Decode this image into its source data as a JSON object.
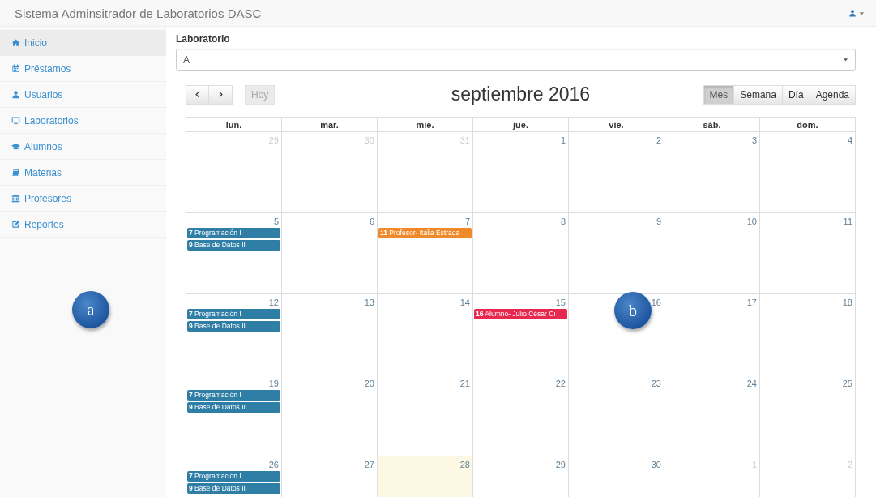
{
  "header": {
    "title": "Sistema Adminsitrador de Laboratorios DASC"
  },
  "sidebar": {
    "items": [
      {
        "label": "Inicio",
        "selected": true
      },
      {
        "label": "Préstamos",
        "selected": false
      },
      {
        "label": "Usuarios",
        "selected": false
      },
      {
        "label": "Laboratorios",
        "selected": false
      },
      {
        "label": "Alumnos",
        "selected": false
      },
      {
        "label": "Materias",
        "selected": false
      },
      {
        "label": "Profesores",
        "selected": false
      },
      {
        "label": "Reportes",
        "selected": false
      }
    ]
  },
  "lab_field": {
    "label": "Laboratorio",
    "value": "A"
  },
  "toolbar": {
    "today": {
      "label": "Hoy",
      "disabled": true
    },
    "title": "septiembre 2016",
    "views": [
      {
        "label": "Mes",
        "selected": true
      },
      {
        "label": "Semana",
        "selected": false
      },
      {
        "label": "Día",
        "selected": false
      },
      {
        "label": "Agenda",
        "selected": false
      }
    ]
  },
  "calendar": {
    "weekdays": [
      "lun.",
      "mar.",
      "mié.",
      "jue.",
      "vie.",
      "sáb.",
      "dom."
    ],
    "weeks": [
      [
        {
          "day": "29",
          "other_month": true,
          "today": false
        },
        {
          "day": "30",
          "other_month": true,
          "today": false
        },
        {
          "day": "31",
          "other_month": true,
          "today": false
        },
        {
          "day": "1",
          "other_month": false,
          "today": false
        },
        {
          "day": "2",
          "other_month": false,
          "today": false
        },
        {
          "day": "3",
          "other_month": false,
          "today": false
        },
        {
          "day": "4",
          "other_month": false,
          "today": false
        }
      ],
      [
        {
          "day": "5",
          "other_month": false,
          "today": false,
          "events": [
            {
              "time": "7",
              "title": "Programación I",
              "color": "#2f7ea6"
            },
            {
              "time": "9",
              "title": "Base de Datos II",
              "color": "#2f7ea6"
            }
          ]
        },
        {
          "day": "6",
          "other_month": false,
          "today": false
        },
        {
          "day": "7",
          "other_month": false,
          "today": false,
          "events": [
            {
              "time": "11",
              "title": "Profesor- Italia Estrada",
              "color": "#f0892a"
            }
          ]
        },
        {
          "day": "8",
          "other_month": false,
          "today": false
        },
        {
          "day": "9",
          "other_month": false,
          "today": false
        },
        {
          "day": "10",
          "other_month": false,
          "today": false
        },
        {
          "day": "11",
          "other_month": false,
          "today": false
        }
      ],
      [
        {
          "day": "12",
          "other_month": false,
          "today": false,
          "events": [
            {
              "time": "7",
              "title": "Programación I",
              "color": "#2f7ea6"
            },
            {
              "time": "9",
              "title": "Base de Datos II",
              "color": "#2f7ea6"
            }
          ]
        },
        {
          "day": "13",
          "other_month": false,
          "today": false
        },
        {
          "day": "14",
          "other_month": false,
          "today": false
        },
        {
          "day": "15",
          "other_month": false,
          "today": false,
          "events": [
            {
              "time": "16",
              "title": "Alumno- Julio César Ci",
              "color": "#e8294f"
            }
          ]
        },
        {
          "day": "16",
          "other_month": false,
          "today": false
        },
        {
          "day": "17",
          "other_month": false,
          "today": false
        },
        {
          "day": "18",
          "other_month": false,
          "today": false
        }
      ],
      [
        {
          "day": "19",
          "other_month": false,
          "today": false,
          "events": [
            {
              "time": "7",
              "title": "Programación I",
              "color": "#2f7ea6"
            },
            {
              "time": "9",
              "title": "Base de Datos II",
              "color": "#2f7ea6"
            }
          ]
        },
        {
          "day": "20",
          "other_month": false,
          "today": false
        },
        {
          "day": "21",
          "other_month": false,
          "today": false
        },
        {
          "day": "22",
          "other_month": false,
          "today": false
        },
        {
          "day": "23",
          "other_month": false,
          "today": false
        },
        {
          "day": "24",
          "other_month": false,
          "today": false
        },
        {
          "day": "25",
          "other_month": false,
          "today": false
        }
      ],
      [
        {
          "day": "26",
          "other_month": false,
          "today": false,
          "events": [
            {
              "time": "7",
              "title": "Programación I",
              "color": "#2f7ea6"
            },
            {
              "time": "9",
              "title": "Base de Datos II",
              "color": "#2f7ea6"
            }
          ]
        },
        {
          "day": "27",
          "other_month": false,
          "today": false
        },
        {
          "day": "28",
          "other_month": false,
          "today": true
        },
        {
          "day": "29",
          "other_month": false,
          "today": false
        },
        {
          "day": "30",
          "other_month": false,
          "today": false
        },
        {
          "day": "1",
          "other_month": true,
          "today": false
        },
        {
          "day": "2",
          "other_month": true,
          "today": false
        }
      ]
    ]
  },
  "annotations": [
    {
      "label": "a"
    },
    {
      "label": "b"
    }
  ]
}
